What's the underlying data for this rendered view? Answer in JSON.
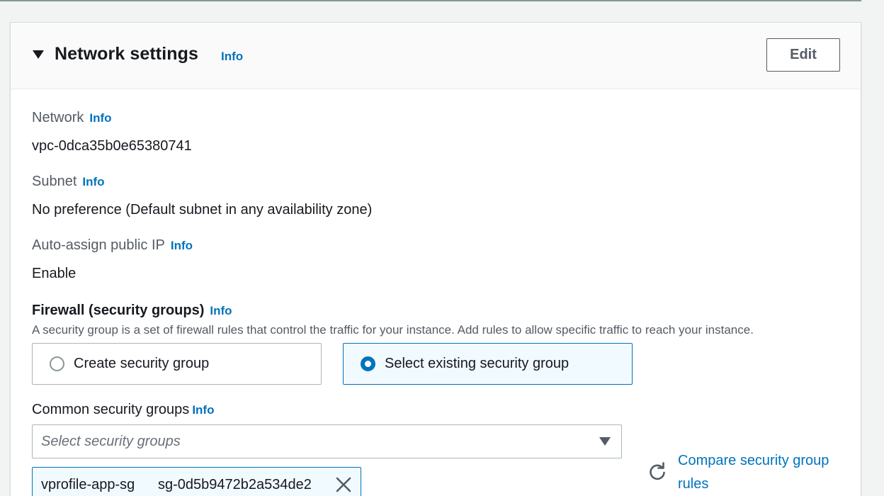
{
  "section": {
    "title": "Network settings",
    "info": "Info",
    "edit_label": "Edit"
  },
  "network": {
    "label": "Network",
    "info": "Info",
    "value": "vpc-0dca35b0e65380741"
  },
  "subnet": {
    "label": "Subnet",
    "info": "Info",
    "value": "No preference (Default subnet in any availability zone)"
  },
  "public_ip": {
    "label": "Auto-assign public IP",
    "info": "Info",
    "value": "Enable"
  },
  "firewall": {
    "label": "Firewall (security groups)",
    "info": "Info",
    "description": "A security group is a set of firewall rules that control the traffic for your instance. Add rules to allow specific traffic to reach your instance.",
    "options": [
      {
        "label": "Create security group",
        "selected": false
      },
      {
        "label": "Select existing security group",
        "selected": true
      }
    ]
  },
  "common_sg": {
    "label": "Common security groups",
    "info": "Info",
    "placeholder": "Select security groups",
    "tokens": [
      {
        "name": "vprofile-app-sg",
        "id": "sg-0d5b9472b2a534de2"
      }
    ],
    "compare_link": "Compare security group rules"
  },
  "colors": {
    "link": "#0073bb",
    "text": "#16191f",
    "muted": "#545b64",
    "selected_bg": "#f1faff"
  }
}
